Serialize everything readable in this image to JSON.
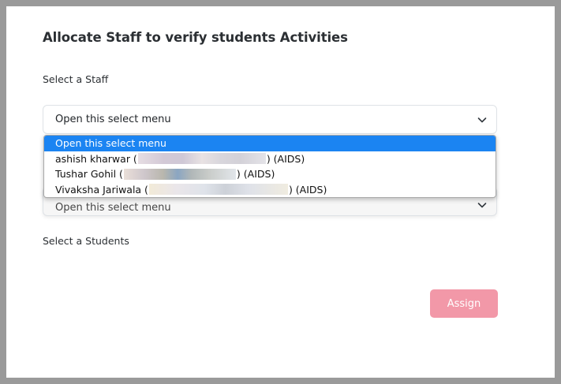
{
  "modal": {
    "title": "Allocate Staff to verify students Activities",
    "staff_label": "Select a Staff",
    "students_label": "Select a Students",
    "assign_label": "Assign"
  },
  "staff_select": {
    "value": "Open this select menu",
    "options": [
      {
        "label": "Open this select menu",
        "selected": true
      },
      {
        "label_prefix": "ashish kharwar (",
        "label_suffix": ") (AIDS)"
      },
      {
        "label_prefix": "Tushar Gohil (",
        "label_suffix": ") (AIDS)"
      },
      {
        "label_prefix": "Vivaksha Jariwala (",
        "label_suffix": ") (AIDS)"
      }
    ]
  },
  "second_select": {
    "value": "Open this select menu"
  },
  "colors": {
    "selected_option": "#1b84f2",
    "assign_button": "#f298a8",
    "backdrop": "#9a9a9a"
  },
  "icons": {
    "select_chevron": "chevron-down-icon"
  }
}
